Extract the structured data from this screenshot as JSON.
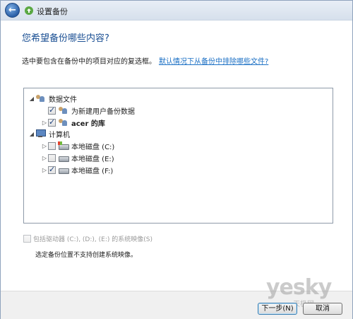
{
  "window": {
    "title": "设置备份"
  },
  "heading": "您希望备份哪些内容?",
  "instruction": {
    "text": "选中要包含在备份中的项目对应的复选框。",
    "link": "默认情况下从备份中排除哪些文件?"
  },
  "tree": {
    "data_files": {
      "label": "数据文件",
      "expanded": true,
      "children": [
        {
          "label": "为新建用户备份数据",
          "checked": true
        },
        {
          "label": "acer 的库",
          "checked": true
        }
      ]
    },
    "computer": {
      "label": "计算机",
      "expanded": true,
      "drives": [
        {
          "label": "本地磁盘 (C:)",
          "checked": false
        },
        {
          "label": "本地磁盘 (E:)",
          "checked": false
        },
        {
          "label": "本地磁盘 (F:)",
          "checked": true
        }
      ]
    }
  },
  "system_image": {
    "label": "包括驱动器 (C:), (D:), (E:) 的系统映像(S)",
    "checked": false,
    "enabled": false
  },
  "note": "选定备份位置不支持创建系统映像。",
  "buttons": {
    "next": "下一步(N)",
    "cancel": "取消"
  },
  "watermark": {
    "main": "yesky",
    "sub": "天极网"
  }
}
